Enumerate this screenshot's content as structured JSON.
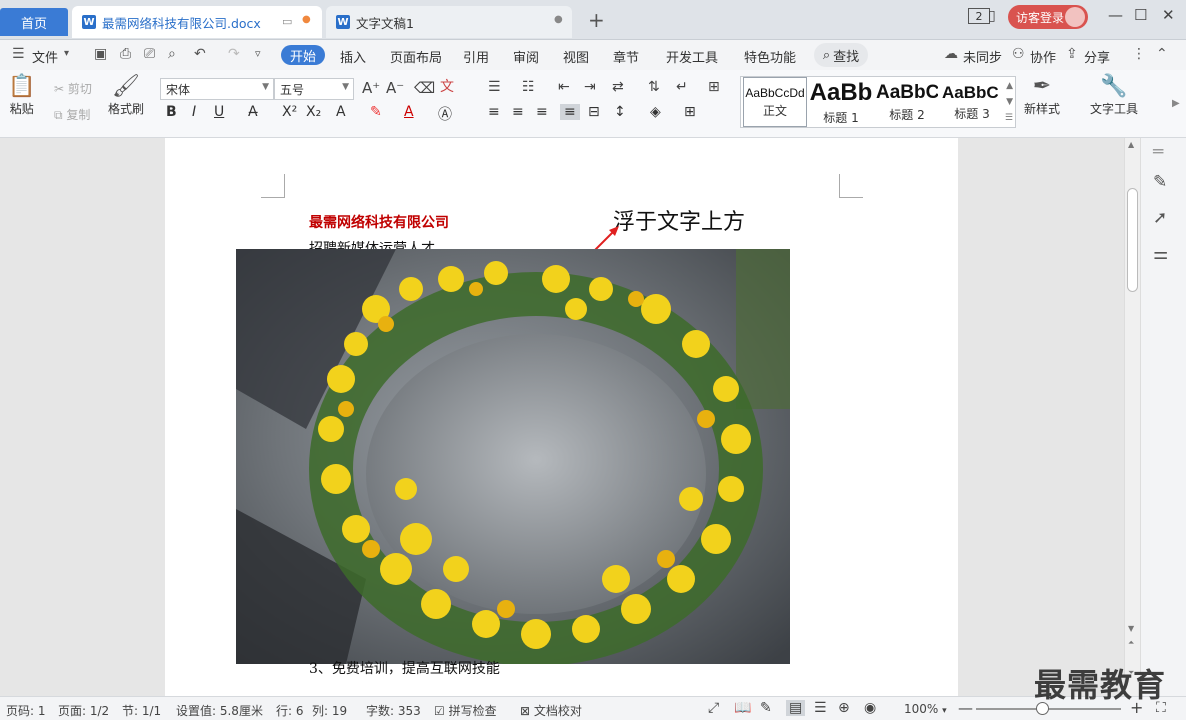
{
  "tabs": {
    "home": "首页",
    "active_doc": "最需网络科技有限公司.docx",
    "inactive_doc": "文字文稿1",
    "new_tab": "+"
  },
  "titlebar": {
    "window_count": "2",
    "login": "访客登录",
    "minimize": "—",
    "maximize": "☐",
    "close": "✕"
  },
  "menu": {
    "file": "文件",
    "items": [
      "开始",
      "插入",
      "页面布局",
      "引用",
      "审阅",
      "视图",
      "章节",
      "开发工具",
      "特色功能"
    ],
    "search": "查找",
    "sync": "未同步",
    "collab": "协作",
    "share": "分享"
  },
  "ribbon": {
    "paste": "粘贴",
    "cut": "剪切",
    "copy": "复制",
    "format_painter": "格式刷",
    "font_name": "宋体",
    "font_size": "五号",
    "new_style": "新样式",
    "text_tools": "文字工具",
    "styles": [
      {
        "sample": "AaBbCcDd",
        "label": "正文"
      },
      {
        "sample": "AaBb",
        "label": "标题 1"
      },
      {
        "sample": "AaBbC",
        "label": "标题 2"
      },
      {
        "sample": "AaBbC",
        "label": "标题 3"
      }
    ]
  },
  "document": {
    "company": "最需网络科技有限公司",
    "line2": "招聘新媒体运营人才",
    "float_label": "浮于文字上方",
    "bottom_line": "3、免费培训，提高互联网技能"
  },
  "status": {
    "page_num": "页码: 1",
    "pages": "页面: 1/2",
    "section": "节: 1/1",
    "setting": "设置值: 5.8厘米",
    "row": "行: 6",
    "col": "列: 19",
    "word_count": "字数: 353",
    "spellcheck": "拼写检查",
    "doc_check": "文档校对",
    "zoom": "100%",
    "zoom_level": 0.46
  },
  "watermark": "最需教育",
  "colors": {
    "accent": "#3a7bd5",
    "company_red": "#c00000",
    "login_red": "#d9534f"
  }
}
